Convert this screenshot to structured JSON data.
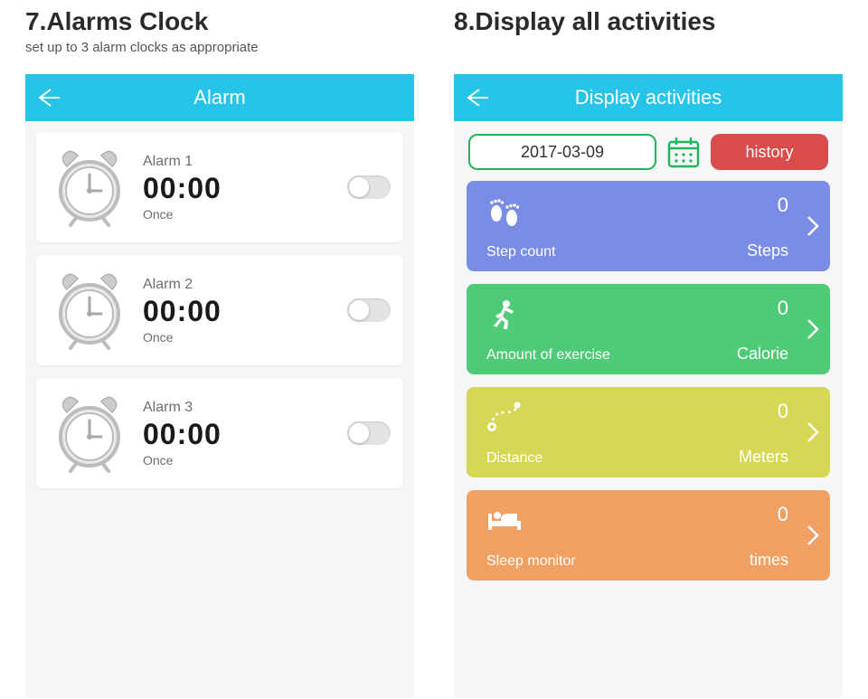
{
  "left": {
    "heading": "7.Alarms Clock",
    "sub": "set up to 3 alarm clocks as appropriate",
    "topbar_title": "Alarm",
    "alarms": [
      {
        "name": "Alarm 1",
        "time": "00:00",
        "repeat": "Once"
      },
      {
        "name": "Alarm 2",
        "time": "00:00",
        "repeat": "Once"
      },
      {
        "name": "Alarm 3",
        "time": "00:00",
        "repeat": "Once"
      }
    ]
  },
  "right": {
    "heading": "8.Display all activities",
    "topbar_title": "Display activities",
    "date": "2017-03-09",
    "history_label": "history",
    "tiles": [
      {
        "name": "Step count",
        "value": "0",
        "unit": "Steps",
        "color": "#7a8de6",
        "icon": "feet"
      },
      {
        "name": "Amount of exercise",
        "value": "0",
        "unit": "Calorie",
        "color": "#4fcb78",
        "icon": "runner"
      },
      {
        "name": "Distance",
        "value": "0",
        "unit": "Meters",
        "color": "#d6d755",
        "icon": "route"
      },
      {
        "name": "Sleep monitor",
        "value": "0",
        "unit": "times",
        "color": "#f0a062",
        "icon": "bed"
      }
    ]
  }
}
